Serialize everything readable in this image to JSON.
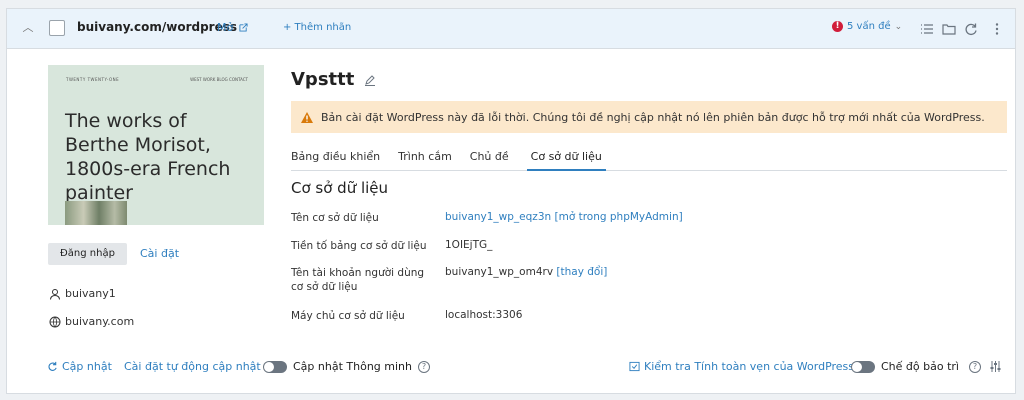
{
  "header": {
    "domain": "buivany.com/wordpress",
    "open_label": "Mở",
    "add_tag_label": "+ Thêm nhãn",
    "issues_count": "!",
    "issues_label": "5 vấn đề",
    "issues_chevron": "⌄"
  },
  "sidebar": {
    "preview": {
      "site_name": "TWENTY TWENTY-ONE",
      "nav_items": "WEST  WORK  BLOG  CONTACT",
      "headline": "The works of Berthe Morisot, 1800s-era French painter"
    },
    "login_button": "Đăng nhập",
    "install_link": "Cài đặt",
    "username": "buivany1",
    "site": "buivany.com"
  },
  "main": {
    "title": "Vpsttt",
    "warning": "Bản cài đặt WordPress này đã lỗi thời. Chúng tôi đề nghị cập nhật nó lên phiên bản được hỗ trợ mới nhất của WordPress.",
    "tabs": [
      {
        "label": "Bảng điều khiển"
      },
      {
        "label": "Trình cắm"
      },
      {
        "label": "Chủ đề"
      },
      {
        "label": "Cơ sở dữ liệu"
      }
    ],
    "section_title": "Cơ sở dữ liệu",
    "rows": [
      {
        "label": "Tên cơ sở dữ liệu",
        "value": "buivany1_wp_eqz3n",
        "link": "[mở trong phpMyAdmin]"
      },
      {
        "label": "Tiền tố bảng cơ sở dữ liệu",
        "value": "1OIEjTG_"
      },
      {
        "label": "Tên tài khoản người dùng cơ sở dữ liệu",
        "value": "buivany1_wp_om4rv",
        "link": "[thay đổi]"
      },
      {
        "label": "Máy chủ cơ sở dữ liệu",
        "value": "localhost:3306"
      }
    ]
  },
  "footer": {
    "update": "Cập nhật",
    "auto_update": "Cài đặt tự động cập nhật",
    "smart_update": "Cập nhật Thông minh",
    "integrity_check": "Kiểm tra Tính toàn vẹn của WordPress",
    "maintenance": "Chế độ bảo trì",
    "help_glyph": "?"
  },
  "colors": {
    "link": "#2f7fbf",
    "header_bg": "#eaf3fb",
    "warning_bg": "#fce8cc",
    "issue_red": "#d11d3a"
  }
}
